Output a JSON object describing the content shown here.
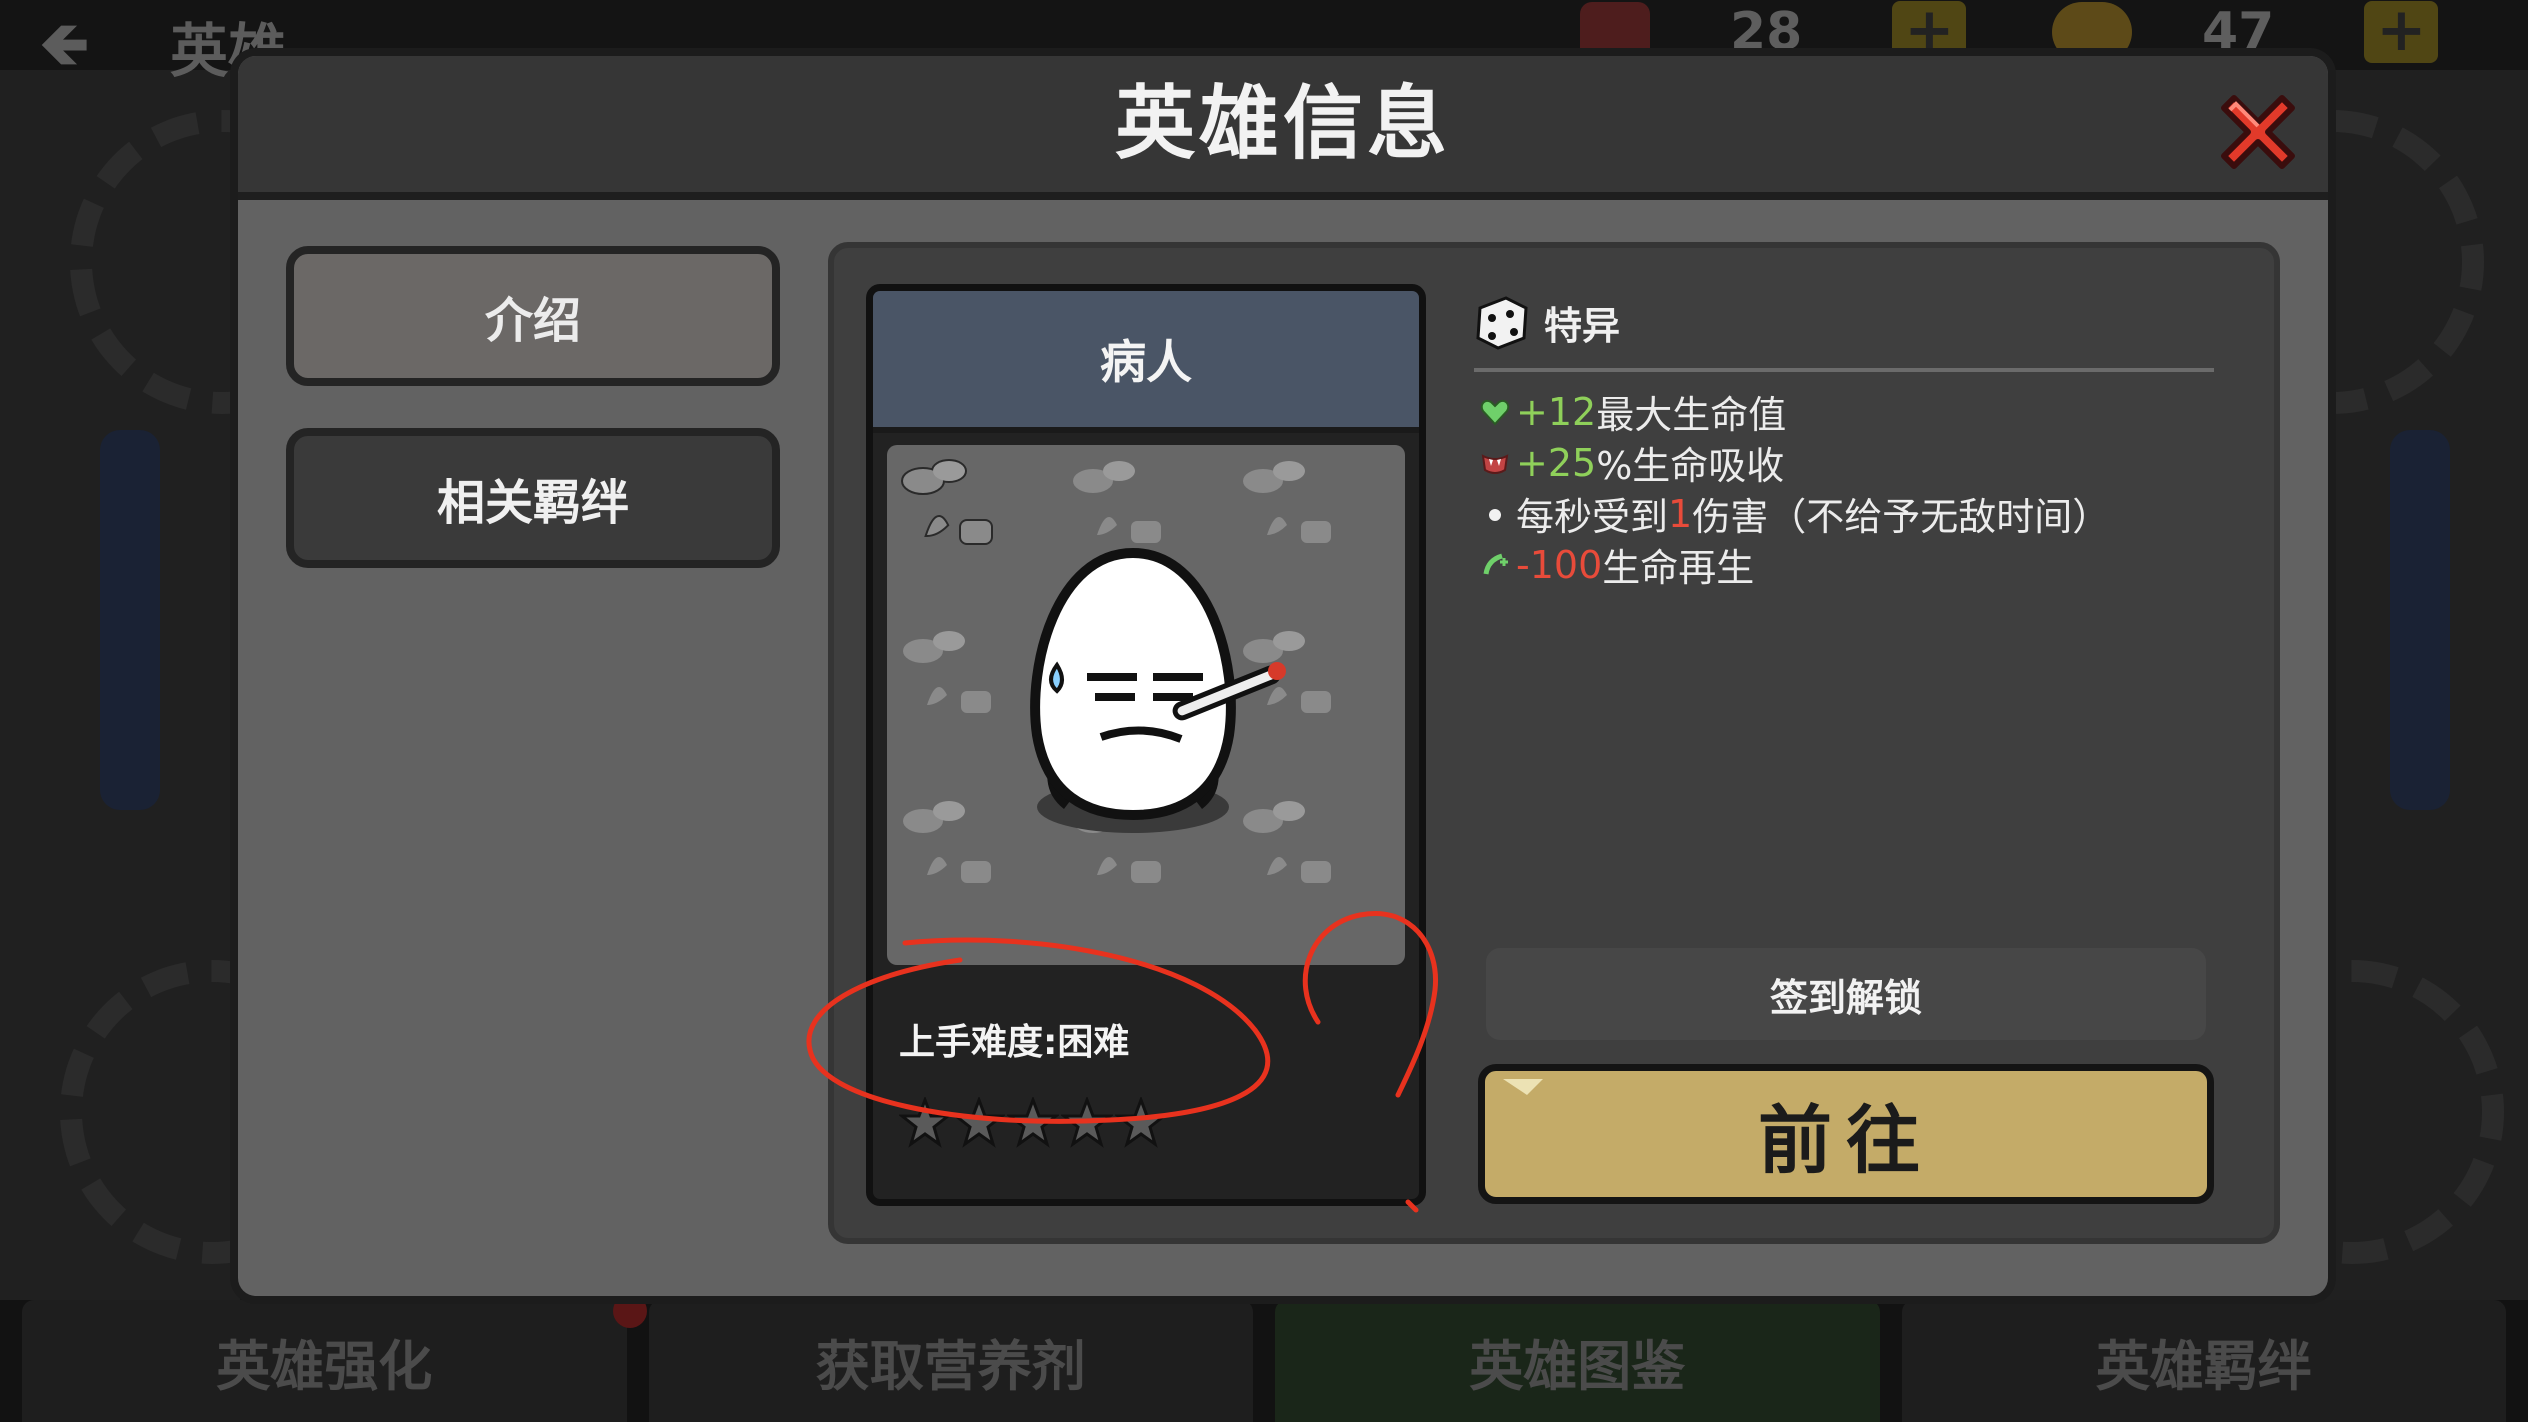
{
  "background": {
    "back_arrow": "🡸",
    "title": "英雄",
    "gems": "28",
    "coins": "47",
    "plus": "+"
  },
  "bottom_nav": [
    {
      "label": "英雄强化",
      "active": false
    },
    {
      "label": "获取营养剂",
      "active": false
    },
    {
      "label": "英雄图鉴",
      "active": true
    },
    {
      "label": "英雄羁绊",
      "active": false
    }
  ],
  "modal": {
    "title": "英雄信息",
    "close": "close",
    "side_tabs": [
      {
        "label": "介绍",
        "active": true
      },
      {
        "label": "相关羁绊",
        "active": false
      }
    ],
    "hero": {
      "name": "病人",
      "difficulty": "上手难度:困难",
      "stars_total": 5,
      "stars_filled": 0
    },
    "trait": {
      "title": "特异",
      "lines": [
        {
          "icon": "heart-icon",
          "value": "+12",
          "value_color": "#8fd05a",
          "text": " 最大生命值"
        },
        {
          "icon": "vampire-mouth-icon",
          "value": "+25",
          "value_color": "#8fd05a",
          "text": " %生命吸收"
        },
        {
          "icon": "bullet-dot-icon",
          "pre": "每秒受到",
          "value": "1",
          "value_color": "#e84b3a",
          "text": "伤害（不给予无敌时间）"
        },
        {
          "icon": "regen-plus-icon",
          "value": "-100",
          "value_color": "#e84b3a",
          "text": " 生命再生"
        }
      ]
    },
    "unlock_text": "签到解锁",
    "go_button": "前往"
  },
  "colors": {
    "accent_gold": "#c4ab68",
    "positive_green": "#8fd05a",
    "negative_red": "#e84b3a",
    "name_bar": "#4a5566",
    "annotation_red": "#e8321e"
  }
}
